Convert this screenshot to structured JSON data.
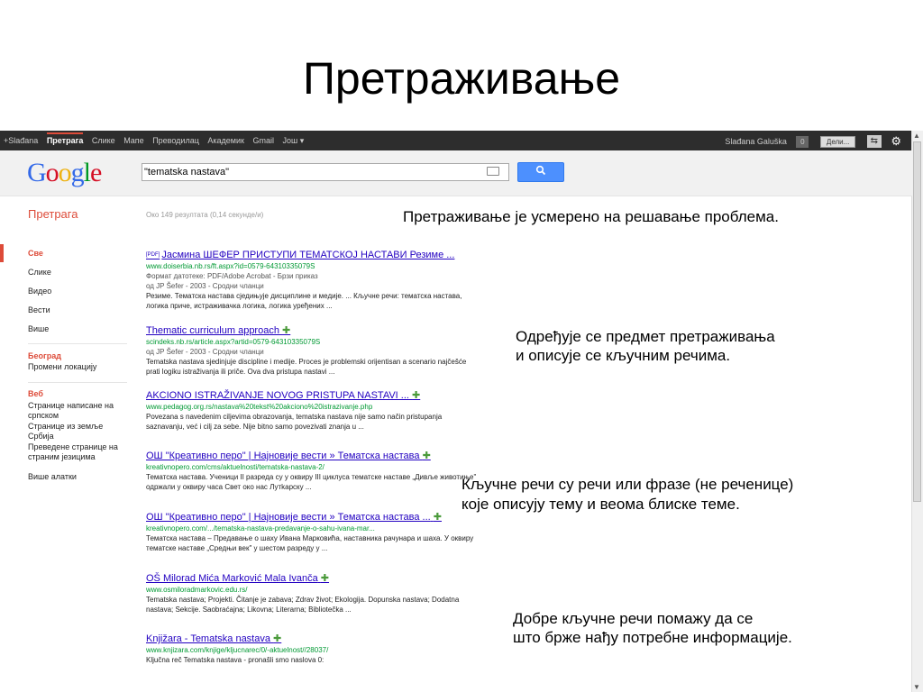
{
  "slide": {
    "title": "Претраживање"
  },
  "topbar": {
    "nav": [
      "+Slađana",
      "Претрага",
      "Слике",
      "Мапе",
      "Преводилац",
      "Академик",
      "Gmail",
      "Још ▾"
    ],
    "user": "Slađana Galuška",
    "badge": "0",
    "share": "Дели...",
    "gear": "⚙"
  },
  "header": {
    "logo": "Google",
    "query": "\"tematska nastava\"",
    "search_icon": "🔍"
  },
  "subheader": {
    "section": "Претрага",
    "stats": "Око 149 резултата (0,14 секунде/и)"
  },
  "sidebar": {
    "types": [
      "Све",
      "Слике",
      "Видео",
      "Вести",
      "Више"
    ],
    "location_title": "Београд",
    "location_change": "Промени локацију",
    "web_title": "Веб",
    "web_items": [
      "Странице написане на српском",
      "Странице из земље Србија",
      "Преведене странице на страним језицима"
    ],
    "tools": "Више алатки"
  },
  "results": [
    {
      "pdf": "[PDF]",
      "title": "Јасмина ШЕФЕР ПРИСТУПИ ТЕМАТСКОЈ НАСТАВИ Резиме ...",
      "url": "www.doiserbia.nb.rs/ft.aspx?id=0579-64310335079S",
      "meta1": "Формат датотеке: PDF/Adobe Acrobat - Брзи приказ",
      "meta2": "од JP Šefer - 2003 - Сродни чланци",
      "snippet": "Резиме. Тематска настава сједињује дисциплине и медије. ... Кључне речи: тематска настава, логика приче, истраживачка логика, логика уређених ..."
    },
    {
      "title": "Thematic curriculum approach",
      "url": "scindeks.nb.rs/article.aspx?artid=0579-64310335079S",
      "meta1": "од JP Šefer - 2003 - Сродни чланци",
      "snippet": "Tematska nastava sjedinjuje discipline i medije. Proces je problemski orijentisan a scenario najčešće prati logiku istraživanja ili priče. Ova dva pristupa nastavi ..."
    },
    {
      "title": "AKCIONO ISTRAŽIVANJE NOVOG PRISTUPA NASTAVI ...",
      "url": "www.pedagog.org.rs/nastava%20tekst%20akciono%20istrazivanje.php",
      "snippet": "Povezana s navedenim ciljevima obrazovanja, tematska nastava nije samo način pristupanja saznavanju, već i cilj za sebe. Nije bitno samo povezivati znanja u ..."
    },
    {
      "title": "ОШ \"Креативно перо\" | Најновије вести » Тематска настава",
      "url": "kreativnopero.com/cms/aktuelnosti/tematska-nastava-2/",
      "snippet": "Тематска настава. Ученици II разреда су у оквиру III циклуса тематске наставе „Дивље животиње\" одржали у оквиру часа Свет око нас Лутkарску ..."
    },
    {
      "title": "ОШ \"Креативно перо\" | Најновије вести » Тематска настава ...",
      "url": "kreativnopero.com/.../tematska-nastava-predavanje-o-sahu-ivana-mar...",
      "snippet": "Тематска настава – Предавање о шаху Ивана Марковића, наставника рачунара и шаха. У оквиру тематске наставе „Средњи век\" у шестом разреду у ..."
    },
    {
      "title": "OŠ Milorad Mića Marković Mala Ivanča",
      "url": "www.osmiloradmarkovic.edu.rs/",
      "snippet": "Tematska nastava; Projekti. Čitanje je zabava; Zdrav život; Ekologija. Dopunska nastava; Dodatna nastava; Sekcije. Saobraćajna; Likovna; Literarna; Bibliotečka ..."
    },
    {
      "title": "Knjižara - Tematska nastava",
      "url": "www.knjizara.com/knjige/kljucnarec/0/-aktuelnost//28037/",
      "snippet": "Ključna reč Tematska nastava - pronašli smo naslova 0:"
    }
  ],
  "annotations": {
    "a1": "Претраживање је усмерено на решавање проблема.",
    "a2_1": "Одређује се предмет претраживања",
    "a2_2": "и описује се кључним речима.",
    "a3_1": "Кључне речи су речи или фразе (не реченице)",
    "a3_2": "које описују тему и веома блиске теме.",
    "a4_1": "Добре кључне речи помажу да се",
    "a4_2": "што брже нађу потребне информације."
  }
}
